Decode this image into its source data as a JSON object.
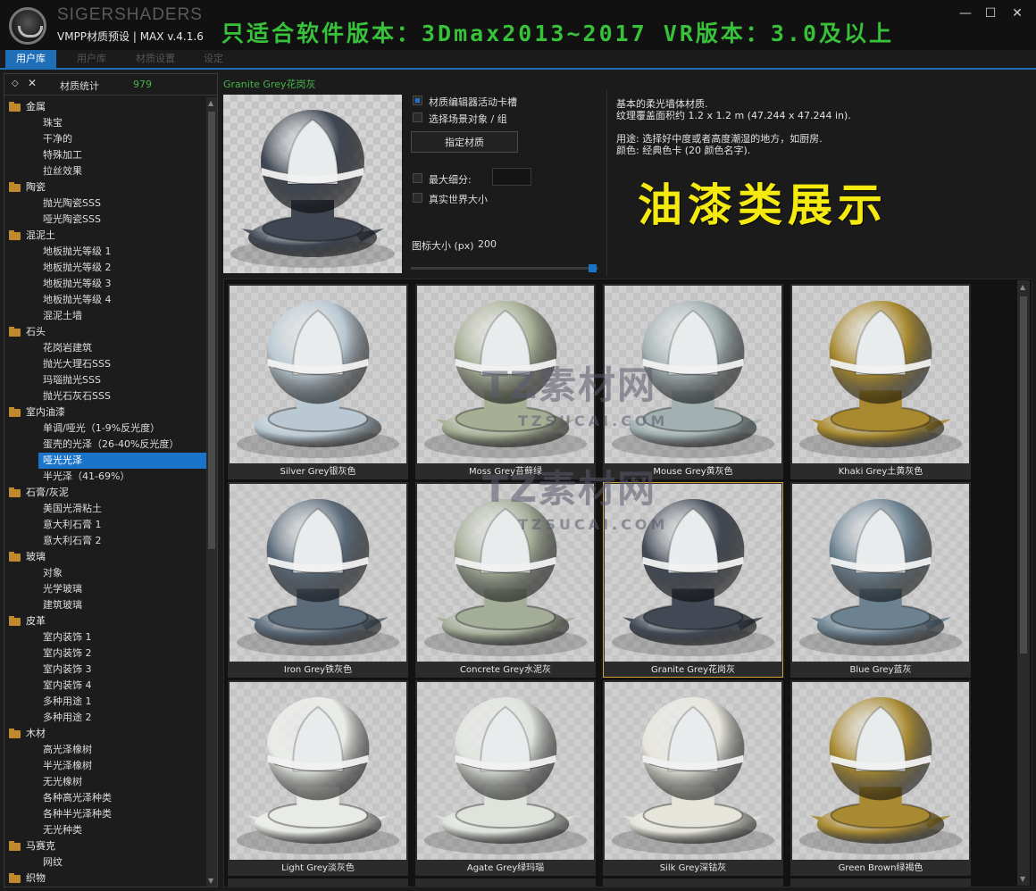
{
  "window": {
    "brand": "SIGERSHADERS",
    "subtitle": "VMPP材质预设 | MAX v.4.1.6",
    "banner": "只适合软件版本：3Dmax2013~2017  VR版本：3.0及以上",
    "controls": [
      "—",
      "☐",
      "✕"
    ]
  },
  "tabs": [
    {
      "label": "用户库",
      "active": true
    },
    {
      "label": "用户库",
      "active": false
    },
    {
      "label": "材质设置",
      "active": false
    },
    {
      "label": "设定",
      "active": false
    }
  ],
  "left_panel": {
    "header_label": "材质统计",
    "header_count": "979",
    "tree": [
      {
        "type": "cat",
        "label": "金属"
      },
      {
        "type": "item",
        "label": "珠宝"
      },
      {
        "type": "item",
        "label": "干净的"
      },
      {
        "type": "item",
        "label": "特殊加工"
      },
      {
        "type": "item",
        "label": "拉丝效果"
      },
      {
        "type": "cat",
        "label": "陶瓷"
      },
      {
        "type": "item",
        "label": "抛光陶瓷SSS"
      },
      {
        "type": "item",
        "label": "哑光陶瓷SSS"
      },
      {
        "type": "cat",
        "label": "混泥土"
      },
      {
        "type": "item",
        "label": "地板抛光等级 1"
      },
      {
        "type": "item",
        "label": "地板抛光等级 2"
      },
      {
        "type": "item",
        "label": "地板抛光等级 3"
      },
      {
        "type": "item",
        "label": "地板抛光等级 4"
      },
      {
        "type": "item",
        "label": "混泥土墙"
      },
      {
        "type": "cat",
        "label": "石头"
      },
      {
        "type": "item",
        "label": "花岗岩建筑"
      },
      {
        "type": "item",
        "label": "抛光大理石SSS"
      },
      {
        "type": "item",
        "label": "玛瑙抛光SSS"
      },
      {
        "type": "item",
        "label": "抛光石灰石SSS"
      },
      {
        "type": "cat",
        "label": "室内油漆"
      },
      {
        "type": "item",
        "label": "单调/哑光（1-9%反光度）"
      },
      {
        "type": "item",
        "label": "蛋壳的光泽（26-40%反光度）"
      },
      {
        "type": "item",
        "label": "哑光光泽",
        "selected": true
      },
      {
        "type": "item",
        "label": "半光泽（41-69%）"
      },
      {
        "type": "cat",
        "label": "石膏/灰泥"
      },
      {
        "type": "item",
        "label": "美国光滑粘土"
      },
      {
        "type": "item",
        "label": "意大利石膏 1"
      },
      {
        "type": "item",
        "label": "意大利石膏 2"
      },
      {
        "type": "cat",
        "label": "玻璃"
      },
      {
        "type": "item",
        "label": "对象"
      },
      {
        "type": "item",
        "label": "光学玻璃"
      },
      {
        "type": "item",
        "label": "建筑玻璃"
      },
      {
        "type": "cat",
        "label": "皮革"
      },
      {
        "type": "item",
        "label": "室内装饰 1"
      },
      {
        "type": "item",
        "label": "室内装饰 2"
      },
      {
        "type": "item",
        "label": "室内装饰 3"
      },
      {
        "type": "item",
        "label": "室内装饰 4"
      },
      {
        "type": "item",
        "label": "多种用途 1"
      },
      {
        "type": "item",
        "label": "多种用途 2"
      },
      {
        "type": "cat",
        "label": "木材"
      },
      {
        "type": "item",
        "label": "高光泽橡树"
      },
      {
        "type": "item",
        "label": "半光泽橡树"
      },
      {
        "type": "item",
        "label": "无光橡树"
      },
      {
        "type": "item",
        "label": "各种高光泽种类"
      },
      {
        "type": "item",
        "label": "各种半光泽种类"
      },
      {
        "type": "item",
        "label": "无光种类"
      },
      {
        "type": "cat",
        "label": "马赛克"
      },
      {
        "type": "item",
        "label": "网纹"
      },
      {
        "type": "cat",
        "label": "织物"
      }
    ]
  },
  "detail": {
    "title": "Granite Grey花岗灰",
    "preview_color": "#3f4652",
    "checkbox_editor": "材质编辑器活动卡槽",
    "checkbox_scene": "选择场景对象 / 组",
    "assign_button": "指定材质",
    "max_subdiv_label": "最大细分:",
    "real_world_label": "真实世界大小",
    "icon_size_label": "图标大小 (px)",
    "icon_size_value": "200",
    "icon_size_fraction": 1.0,
    "description_lines": [
      "基本的柔光墙体材质.",
      "纹理覆盖面积约 1.2 x 1.2 m (47.244 x 47.244 in).",
      "",
      "用途: 选择好中度或者高度潮湿的地方，如厨房.",
      "颜色: 经典色卡 (20 颜色名字)."
    ],
    "overlay_text": "油漆类展示"
  },
  "materials": [
    {
      "name": "Silver Grey银灰色",
      "color": "#b9c8d2"
    },
    {
      "name": "Moss Grey苔藓绿",
      "color": "#a6ae94"
    },
    {
      "name": "Mouse Grey黄灰色",
      "color": "#a2b0b1"
    },
    {
      "name": "Khaki Grey土黄灰色",
      "color": "#a8892f"
    },
    {
      "name": "Iron Grey铁灰色",
      "color": "#5b6a79"
    },
    {
      "name": "Concrete Grey水泥灰",
      "color": "#a4ad98"
    },
    {
      "name": "Granite Grey花岗灰",
      "color": "#424955",
      "selected": true
    },
    {
      "name": "Blue Grey蓝灰",
      "color": "#6c8291"
    },
    {
      "name": "Light Grey淡灰色",
      "color": "#e8ebe6"
    },
    {
      "name": "Agate Grey绿玛瑙",
      "color": "#dfe3dc"
    },
    {
      "name": "Silk Grey深钴灰",
      "color": "#e6e5dc"
    },
    {
      "name": "Green Brown绿褐色",
      "color": "#a88a33"
    }
  ],
  "watermarks": {
    "main": "TZ素材网",
    "sub": "TZSUCAI.COM"
  }
}
